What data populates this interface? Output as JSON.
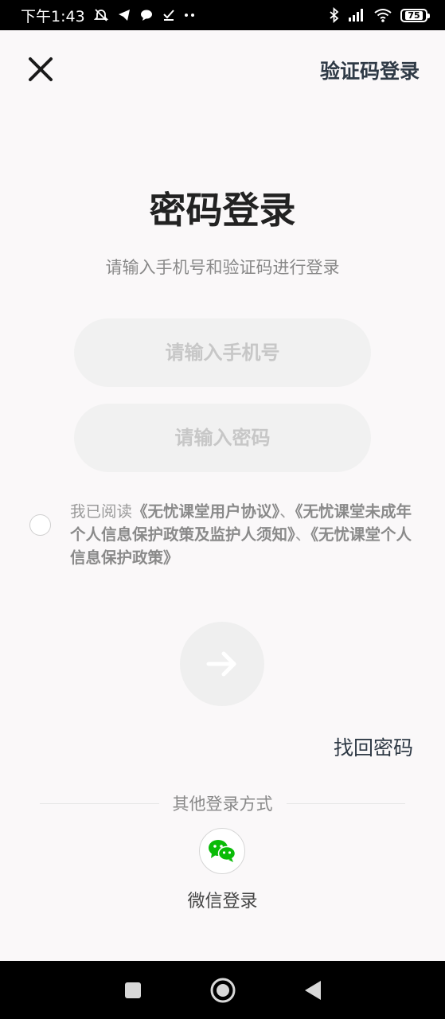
{
  "status_bar": {
    "time": "下午1:43",
    "battery": "75"
  },
  "header": {
    "switch_label": "验证码登录"
  },
  "main": {
    "title": "密码登录",
    "subtitle": "请输入手机号和验证码进行登录",
    "phone_placeholder": "请输入手机号",
    "password_placeholder": "请输入密码"
  },
  "agreement": {
    "prefix": "我已阅读",
    "link1": "《无忧课堂用户协议》",
    "sep1": "、",
    "link2": "《无忧课堂未成年个人信息保护政策及监护人须知》",
    "sep2": "、",
    "link3": "《无忧课堂个人信息保护政策》"
  },
  "forgot_label": "找回密码",
  "other_login": {
    "label": "其他登录方式",
    "wechat_label": "微信登录"
  },
  "colors": {
    "accent_text": "#2f3a46",
    "wechat_green": "#09bb07",
    "input_bg": "#f1f1f1"
  }
}
